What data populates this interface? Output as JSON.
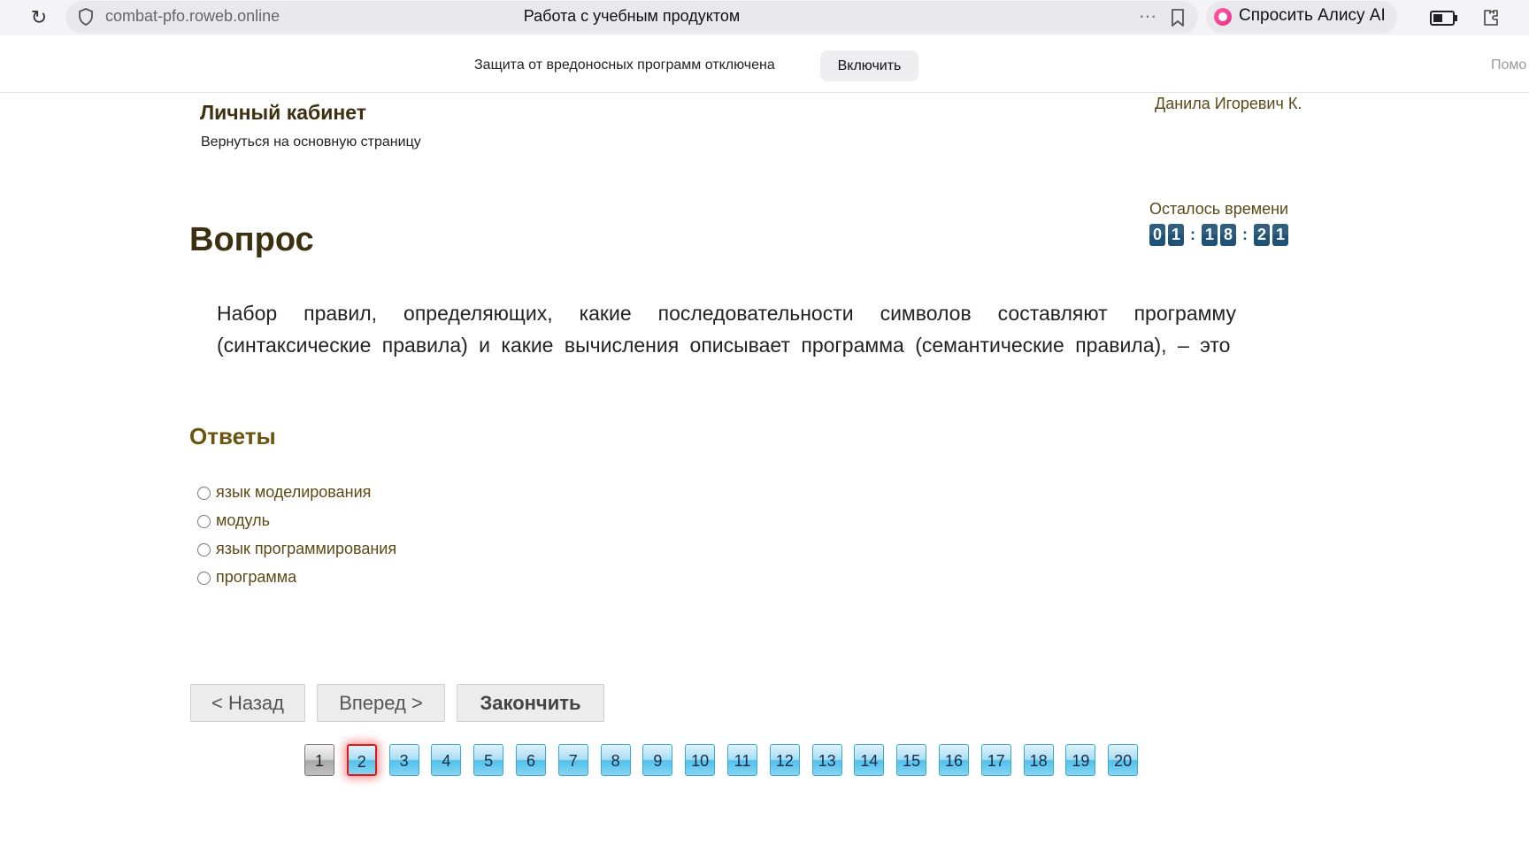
{
  "browser": {
    "url": "combat-pfo.roweb.online",
    "page_title": "Работа с учебным продуктом",
    "alice_label": "Спросить Алису AI"
  },
  "security_bar": {
    "message": "Защита от вредоносных программ отключена",
    "enable_label": "Включить",
    "help_label": "Помо"
  },
  "header": {
    "cabinet_title": "Личный кабинет",
    "back_link": "Вернуться на основную страницу",
    "user_name": "Данила Игоревич К."
  },
  "timer": {
    "label": "Осталось времени",
    "digits": [
      "0",
      "1",
      "1",
      "8",
      "2",
      "1"
    ],
    "separator": ":"
  },
  "question": {
    "heading": "Вопрос",
    "text": "Набор правил, определяющих, какие последовательности символов составляют программу (синтаксические правила) и какие вычисления описывает программа (семантические правила), – это"
  },
  "answers": {
    "heading": "Ответы",
    "options": [
      "язык моделирования",
      "модуль",
      "язык программирования",
      "программа"
    ]
  },
  "navigation": {
    "back_label": "< Назад",
    "next_label": "Вперед >",
    "finish_label": "Закончить"
  },
  "pagination": {
    "pages": [
      "1",
      "2",
      "3",
      "4",
      "5",
      "6",
      "7",
      "8",
      "9",
      "10",
      "11",
      "12",
      "13",
      "14",
      "15",
      "16",
      "17",
      "18",
      "19",
      "20"
    ],
    "current": "2",
    "visited": "1"
  }
}
